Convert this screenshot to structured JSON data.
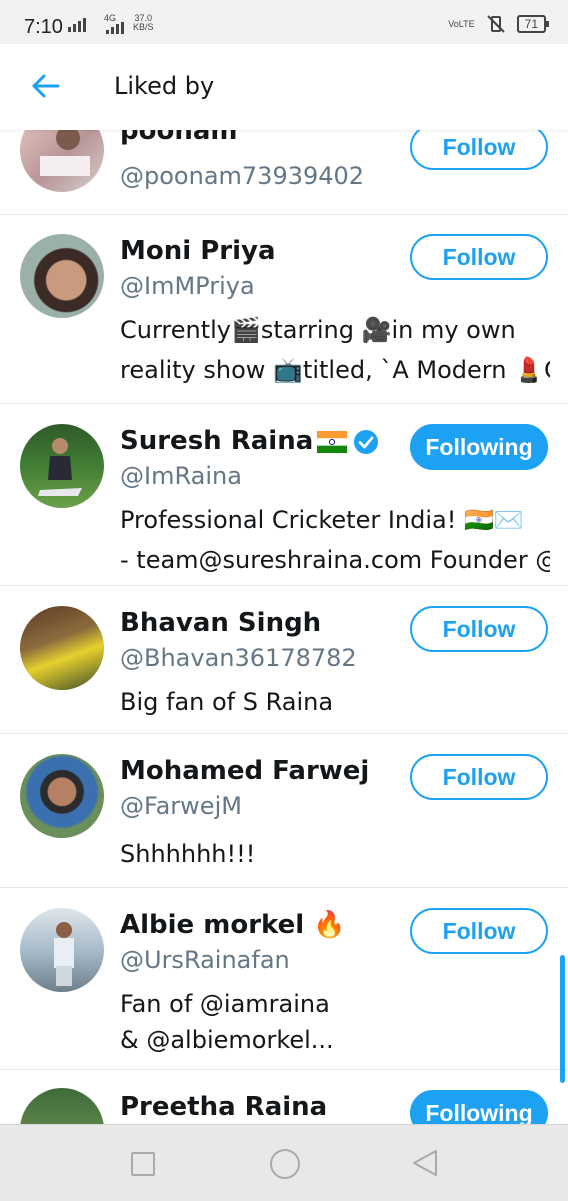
{
  "status": {
    "time": "7:10",
    "network": "4G",
    "speed_value": "37.0",
    "speed_unit": "KB/S",
    "volte": "VoLTE",
    "battery": "71"
  },
  "header": {
    "title": "Liked by"
  },
  "users": [
    {
      "name": "poonam",
      "handle": "@poonam73939402",
      "bio": [],
      "button": "Follow",
      "following": false
    },
    {
      "name": "Moni Priya",
      "handle": "@ImMPriya",
      "bio": [
        "Currently🎬starring 🎥in my own",
        "reality show 📺titled, `A Modern 💄CI..."
      ],
      "button": "Follow",
      "following": false
    },
    {
      "name": "Suresh Raina",
      "handle": "@ImRaina",
      "bio": [
        "Professional Cricketer India! 🇮🇳✉️",
        "- team@sureshraina.com Founder @gr..."
      ],
      "button": "Following",
      "following": true
    },
    {
      "name": "Bhavan Singh",
      "handle": "@Bhavan36178782",
      "bio": [
        "Big fan of S Raina"
      ],
      "button": "Follow",
      "following": false
    },
    {
      "name": "Mohamed Farwej",
      "handle": "@FarwejM",
      "bio": [
        "Shhhhhh!!!"
      ],
      "button": "Follow",
      "following": false
    },
    {
      "name": "Albie morkel 🔥",
      "handle": "@UrsRainafan",
      "bio": [
        "Fan of @iamraina",
        "& @albiemorkel..."
      ],
      "button": "Follow",
      "following": false
    },
    {
      "name": "Preetha Raina",
      "handle": "",
      "bio": [],
      "button": "Following",
      "following": true
    }
  ],
  "colors": {
    "accent": "#1da1f2",
    "secondary_text": "#657786",
    "divider": "#e1e8ed"
  }
}
